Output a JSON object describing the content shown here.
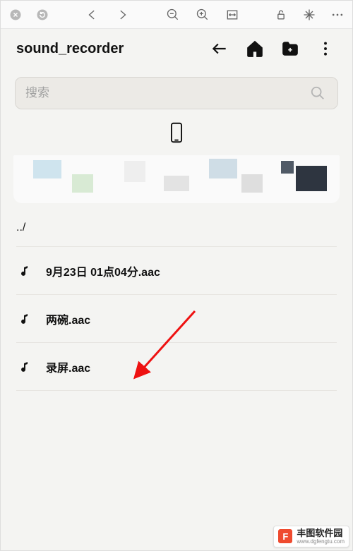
{
  "header": {
    "title": "sound_recorder"
  },
  "search": {
    "placeholder": "搜索"
  },
  "list": {
    "parent": "../",
    "items": [
      {
        "name": "9月23日 01点04分.aac"
      },
      {
        "name": "两碗.aac"
      },
      {
        "name": "录屏.aac"
      }
    ]
  },
  "watermark": {
    "badge": "F",
    "title": "丰图软件园",
    "subtitle": "www.dgfengtu.com"
  }
}
